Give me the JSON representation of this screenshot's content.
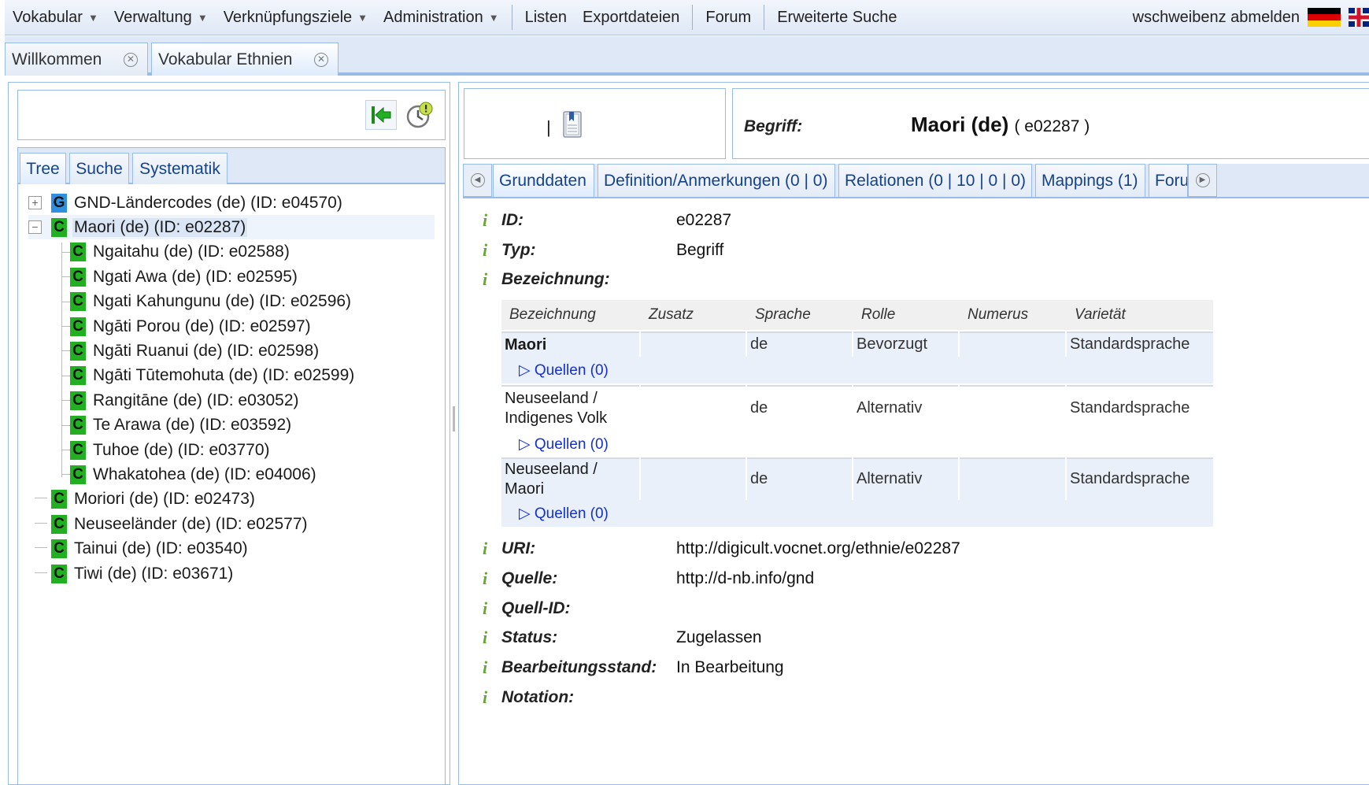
{
  "menu": {
    "items": [
      {
        "label": "Vokabular",
        "dropdown": true
      },
      {
        "label": "Verwaltung",
        "dropdown": true
      },
      {
        "label": "Verknüpfungsziele",
        "dropdown": true
      },
      {
        "label": "Administration",
        "dropdown": true
      },
      {
        "label": "Listen",
        "dropdown": false
      },
      {
        "label": "Exportdateien",
        "dropdown": false
      },
      {
        "label": "Forum",
        "dropdown": false
      },
      {
        "label": "Erweiterte Suche",
        "dropdown": false
      }
    ],
    "logout": "wschweibenz abmelden",
    "flags": [
      "flag-de-icon",
      "flag-en-icon"
    ]
  },
  "tabs": [
    {
      "label": "Willkommen",
      "active": false
    },
    {
      "label": "Vokabular Ethnien",
      "active": true
    }
  ],
  "left": {
    "tree_tabs": [
      "Tree",
      "Suche",
      "Systematik"
    ],
    "active_tree_tab": "Tree",
    "tree": [
      {
        "label": "GND-Ländercodes (de) (ID: e04570)",
        "type": "G",
        "level": 0,
        "expander": "+"
      },
      {
        "label": "Maori (de) (ID: e02287)",
        "type": "C",
        "level": 0,
        "expander": "−",
        "selected": true
      },
      {
        "label": "Ngaitahu (de) (ID: e02588)",
        "type": "C",
        "level": 1
      },
      {
        "label": "Ngati Awa (de) (ID: e02595)",
        "type": "C",
        "level": 1
      },
      {
        "label": "Ngati Kahungunu (de) (ID: e02596)",
        "type": "C",
        "level": 1
      },
      {
        "label": "Ngāti Porou (de) (ID: e02597)",
        "type": "C",
        "level": 1
      },
      {
        "label": "Ngāti Ruanui (de) (ID: e02598)",
        "type": "C",
        "level": 1
      },
      {
        "label": "Ngāti Tūtemohuta (de) (ID: e02599)",
        "type": "C",
        "level": 1
      },
      {
        "label": "Rangitāne (de) (ID: e03052)",
        "type": "C",
        "level": 1
      },
      {
        "label": "Te Arawa (de) (ID: e03592)",
        "type": "C",
        "level": 1
      },
      {
        "label": "Tuhoe (de) (ID: e03770)",
        "type": "C",
        "level": 1
      },
      {
        "label": "Whakatohea (de) (ID: e04006)",
        "type": "C",
        "level": 1
      },
      {
        "label": "Moriori (de) (ID: e02473)",
        "type": "C",
        "level": 0
      },
      {
        "label": "Neuseeländer (de) (ID: e02577)",
        "type": "C",
        "level": 0
      },
      {
        "label": "Tainui (de) (ID: e03540)",
        "type": "C",
        "level": 0
      },
      {
        "label": "Tiwi (de) (ID: e03671)",
        "type": "C",
        "level": 0
      }
    ]
  },
  "header": {
    "begriff_label": "Begriff:",
    "name": "Maori (de)",
    "id_text": "( e02287 )",
    "separator": "|"
  },
  "detail_tabs": [
    {
      "label": "Grunddaten",
      "active": true
    },
    {
      "label": "Definition/Anmerkungen (0 | 0)",
      "active": false
    },
    {
      "label": "Relationen (0 | 10 | 0 | 0)",
      "active": false
    },
    {
      "label": "Mappings (1)",
      "active": false
    },
    {
      "label": "Foru",
      "active": false
    }
  ],
  "info_glyph": "i",
  "fields": {
    "id": {
      "label": "ID:",
      "value": "e02287"
    },
    "typ": {
      "label": "Typ:",
      "value": "Begriff"
    },
    "bezeichnung": {
      "label": "Bezeichnung:"
    },
    "uri": {
      "label": "URI:",
      "value": "http://digicult.vocnet.org/ethnie/e02287"
    },
    "quelle": {
      "label": "Quelle:",
      "value": "http://d-nb.info/gnd"
    },
    "quell_id": {
      "label": "Quell-ID:",
      "value": ""
    },
    "status": {
      "label": "Status:",
      "value": "Zugelassen"
    },
    "bearbeitungsstand": {
      "label": "Bearbeitungsstand:",
      "value": "In Bearbeitung"
    },
    "notation": {
      "label": "Notation:",
      "value": ""
    }
  },
  "bezeichnung_table": {
    "columns": [
      "Bezeichnung",
      "Zusatz",
      "Sprache",
      "Rolle",
      "Numerus",
      "Varietät"
    ],
    "rows": [
      {
        "name_lines": [
          "Maori"
        ],
        "zusatz": "",
        "sprache": "de",
        "rolle": "Bevorzugt",
        "numerus": "",
        "varietaet": "Standardsprache",
        "quellen": "▷ Quellen (0)"
      },
      {
        "name_lines": [
          "Neuseeland /",
          "Indigenes Volk"
        ],
        "zusatz": "",
        "sprache": "de",
        "rolle": "Alternativ",
        "numerus": "",
        "varietaet": "Standardsprache",
        "quellen": "▷ Quellen (0)"
      },
      {
        "name_lines": [
          "Neuseeland /",
          "Maori"
        ],
        "zusatz": "",
        "sprache": "de",
        "rolle": "Alternativ",
        "numerus": "",
        "varietaet": "Standardsprache",
        "quellen": "▷ Quellen (0)"
      }
    ]
  },
  "colors": {
    "accent": "#99bbe8",
    "tab_bg": "#dfe8f6",
    "node_c": "#22b022",
    "node_g": "#2f8fe0",
    "info_i": "#6aa33a",
    "link": "#1530d0"
  }
}
